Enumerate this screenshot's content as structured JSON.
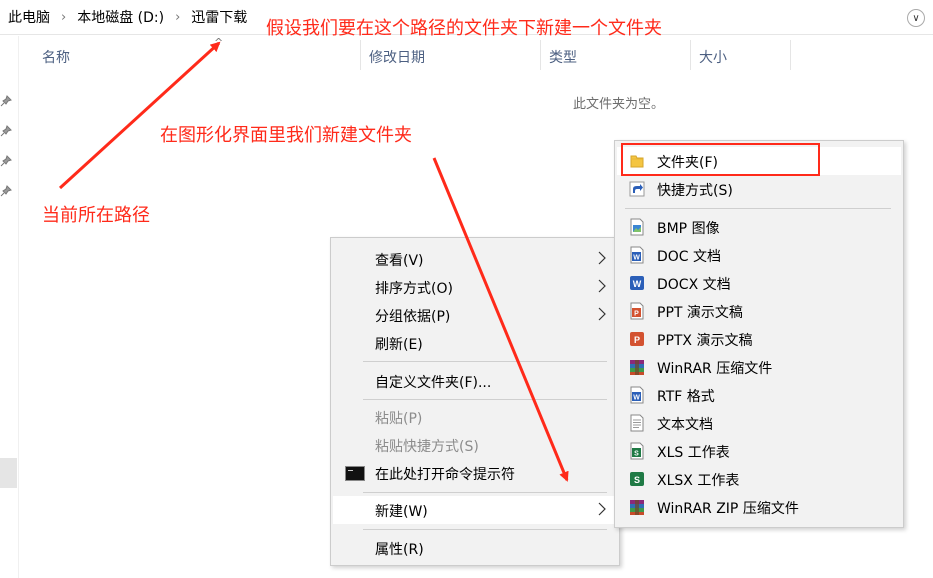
{
  "address_bar": {
    "crumbs": [
      "此电脑",
      "本地磁盘 (D:)",
      "迅雷下载"
    ]
  },
  "columns": {
    "name": "名称",
    "modified": "修改日期",
    "type": "类型",
    "size": "大小"
  },
  "empty_message": "此文件夹为空。",
  "annotations": {
    "top": "假设我们要在这个路径的文件夹下新建一个文件夹",
    "middle": "在图形化界面里我们新建文件夹",
    "left": "当前所在路径"
  },
  "context_menu": {
    "items": [
      {
        "label": "查看(V)",
        "submenu": true
      },
      {
        "label": "排序方式(O)",
        "submenu": true
      },
      {
        "label": "分组依据(P)",
        "submenu": true
      },
      {
        "label": "刷新(E)"
      },
      {
        "label": "自定义文件夹(F)..."
      },
      {
        "label": "粘贴(P)",
        "disabled": true
      },
      {
        "label": "粘贴快捷方式(S)",
        "disabled": true
      },
      {
        "label": "在此处打开命令提示符",
        "icon": "command-prompt-icon"
      },
      {
        "label": "新建(W)",
        "submenu": true,
        "highlighted": true
      },
      {
        "label": "属性(R)"
      }
    ]
  },
  "new_submenu": {
    "items": [
      {
        "label": "文件夹(F)",
        "icon": "folder-icon"
      },
      {
        "label": "快捷方式(S)",
        "icon": "shortcut-icon"
      },
      {
        "label": "BMP 图像",
        "icon": "bmp-image-icon"
      },
      {
        "label": "DOC 文档",
        "icon": "word-doc-icon"
      },
      {
        "label": "DOCX 文档",
        "icon": "word-docx-icon"
      },
      {
        "label": "PPT 演示文稿",
        "icon": "ppt-icon"
      },
      {
        "label": "PPTX 演示文稿",
        "icon": "pptx-icon"
      },
      {
        "label": "WinRAR 压缩文件",
        "icon": "winrar-icon"
      },
      {
        "label": "RTF 格式",
        "icon": "rtf-icon"
      },
      {
        "label": "文本文档",
        "icon": "text-document-icon"
      },
      {
        "label": "XLS 工作表",
        "icon": "xls-icon"
      },
      {
        "label": "XLSX 工作表",
        "icon": "xlsx-icon"
      },
      {
        "label": "WinRAR ZIP 压缩文件",
        "icon": "winrar-zip-icon"
      }
    ]
  },
  "colors": {
    "annotation_red": "#ff2a1a",
    "menu_background": "#f2f2f2",
    "word_blue": "#2b5fb8",
    "ppt_orange": "#d35230",
    "excel_green": "#1f7a45"
  }
}
